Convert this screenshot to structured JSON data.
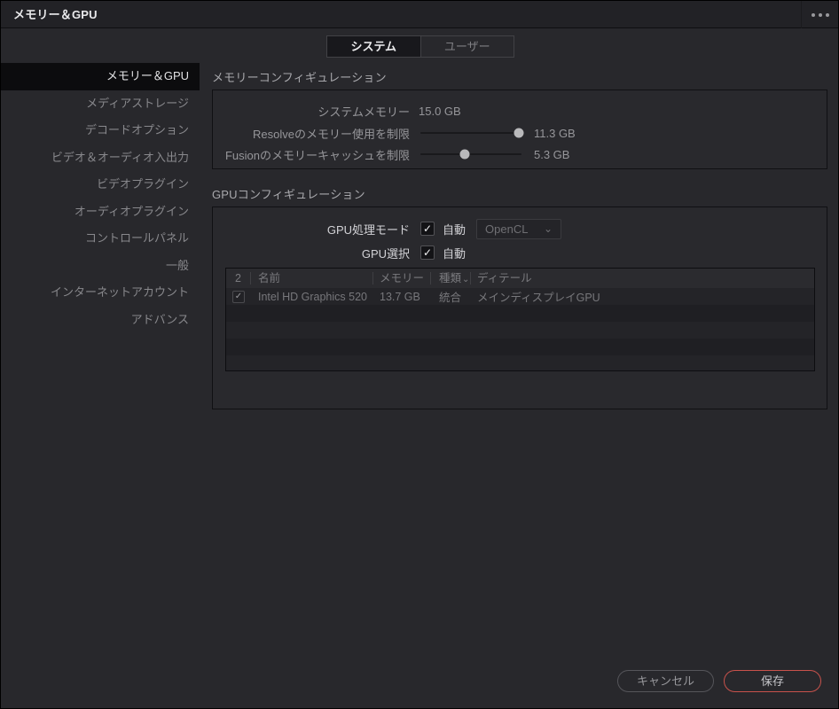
{
  "window": {
    "title": "メモリー＆GPU"
  },
  "icons": {
    "check": "✓",
    "chevron_down": "⌄",
    "sort_caret": "⌄"
  },
  "tabs": {
    "system": "システム",
    "user": "ユーザー"
  },
  "sidebar": {
    "items": [
      "メモリー＆GPU",
      "メディアストレージ",
      "デコードオプション",
      "ビデオ＆オーディオ入出力",
      "ビデオプラグイン",
      "オーディオプラグイン",
      "コントロールパネル",
      "一般",
      "インターネットアカウント",
      "アドバンス"
    ],
    "selected_index": 0
  },
  "memory_section": {
    "heading": "メモリーコンフィギュレーション",
    "system_memory_label": "システムメモリー",
    "system_memory_value": "15.0 GB",
    "sliders": [
      {
        "label": "Resolveのメモリー使用を制限",
        "value": "11.3 GB",
        "percent": 97
      },
      {
        "label": "Fusionのメモリーキャッシュを制限",
        "value": "5.3 GB",
        "percent": 44
      }
    ]
  },
  "gpu_section": {
    "heading": "GPUコンフィギュレーション",
    "processing_mode_label": "GPU処理モード",
    "processing_mode_auto": "自動",
    "dropdown_value": "OpenCL",
    "gpu_select_label": "GPU選択",
    "gpu_select_auto": "自動",
    "table": {
      "headers": {
        "count": "2",
        "name": "名前",
        "memory": "メモリー",
        "type": "種類",
        "detail": "ディテール"
      },
      "rows": [
        {
          "checked": true,
          "name": "Intel HD Graphics 520",
          "memory": "13.7 GB",
          "type": "統合",
          "detail": "メインディスプレイGPU"
        }
      ]
    }
  },
  "footer": {
    "cancel": "キャンセル",
    "save": "保存"
  },
  "colors": {
    "background": "#28282c",
    "titlebar": "#222226",
    "selected_sidebar": "#0c0c0e",
    "accent_red": "#c8524c"
  }
}
